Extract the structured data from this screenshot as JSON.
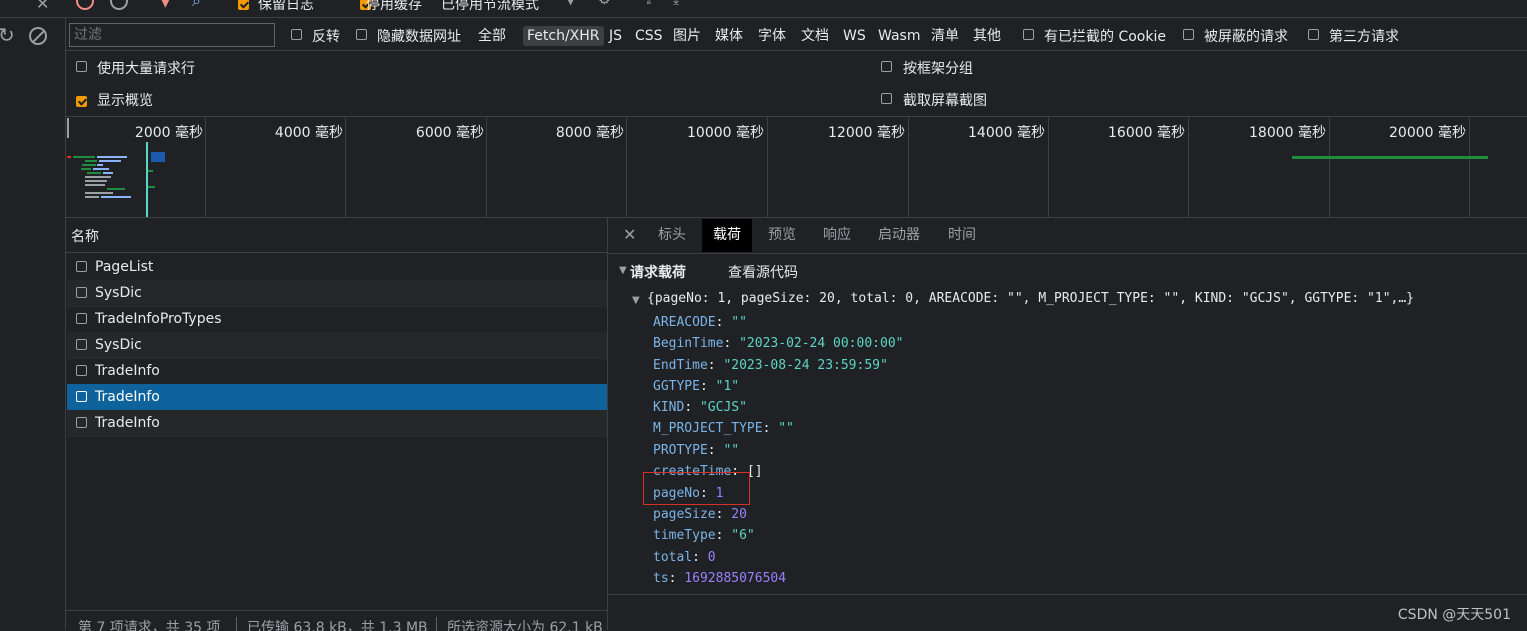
{
  "toolbar": {
    "preserve_log": "保留日志",
    "disable_cache": "停用缓存",
    "throttle": "已停用节流模式"
  },
  "filter": {
    "placeholder": "过滤",
    "invert": "反转",
    "hide_data_urls": "隐藏数据网址",
    "types": [
      "全部",
      "Fetch/XHR",
      "JS",
      "CSS",
      "图片",
      "媒体",
      "字体",
      "文档",
      "WS",
      "Wasm",
      "清单",
      "其他"
    ],
    "selected_type": "Fetch/XHR",
    "blocked_cookies": "有已拦截的 Cookie",
    "blocked_requests": "被屏蔽的请求",
    "third_party": "第三方请求"
  },
  "options": {
    "big_rows": "使用大量请求行",
    "group_by_frame": "按框架分组",
    "show_overview": "显示概览",
    "capture_screenshots": "截取屏幕截图"
  },
  "timeline": {
    "ticks": [
      "2000 毫秒",
      "4000 毫秒",
      "6000 毫秒",
      "8000 毫秒",
      "10000 毫秒",
      "12000 毫秒",
      "14000 毫秒",
      "16000 毫秒",
      "18000 毫秒",
      "20000 毫秒"
    ]
  },
  "requests": {
    "header": "名称",
    "rows": [
      "PageList",
      "SysDic",
      "TradeInfoProTypes",
      "SysDic",
      "TradeInfo",
      "TradeInfo",
      "TradeInfo"
    ],
    "selected_index": 5
  },
  "status_bar": {
    "count": "第 7 项请求，共 35 项",
    "transferred": "已传输 63.8 kB，共 1.3 MB",
    "resources": "所选资源大小为 62.1 kB"
  },
  "detail": {
    "tabs": [
      "标头",
      "载荷",
      "预览",
      "响应",
      "启动器",
      "时间"
    ],
    "active_tab": "载荷",
    "section_title": "请求载荷",
    "view_source": "查看源代码",
    "summary": "{pageNo: 1, pageSize: 20, total: 0, AREACODE: \"\", M_PROJECT_TYPE: \"\", KIND: \"GCJS\", GGTYPE: \"1\",…}",
    "props": [
      {
        "key": "AREACODE",
        "value": "\"\"",
        "kind": "string"
      },
      {
        "key": "BeginTime",
        "value": "\"2023-02-24 00:00:00\"",
        "kind": "string"
      },
      {
        "key": "EndTime",
        "value": "\"2023-08-24 23:59:59\"",
        "kind": "string"
      },
      {
        "key": "GGTYPE",
        "value": "\"1\"",
        "kind": "string"
      },
      {
        "key": "KIND",
        "value": "\"GCJS\"",
        "kind": "string"
      },
      {
        "key": "M_PROJECT_TYPE",
        "value": "\"\"",
        "kind": "string"
      },
      {
        "key": "PROTYPE",
        "value": "\"\"",
        "kind": "string"
      },
      {
        "key": "createTime",
        "value": "[]",
        "kind": "array"
      },
      {
        "key": "pageNo",
        "value": "1",
        "kind": "number"
      },
      {
        "key": "pageSize",
        "value": "20",
        "kind": "number"
      },
      {
        "key": "timeType",
        "value": "\"6\"",
        "kind": "string"
      },
      {
        "key": "total",
        "value": "0",
        "kind": "number"
      },
      {
        "key": "ts",
        "value": "1692885076504",
        "kind": "number"
      }
    ]
  },
  "watermark": "CSDN @天天501",
  "colors": {
    "background": "#202124",
    "selected_row": "#0e639c",
    "checkbox_checked": "#f29900",
    "highlight_box": "#d93025",
    "timeline_green": "#1e8e3e"
  }
}
